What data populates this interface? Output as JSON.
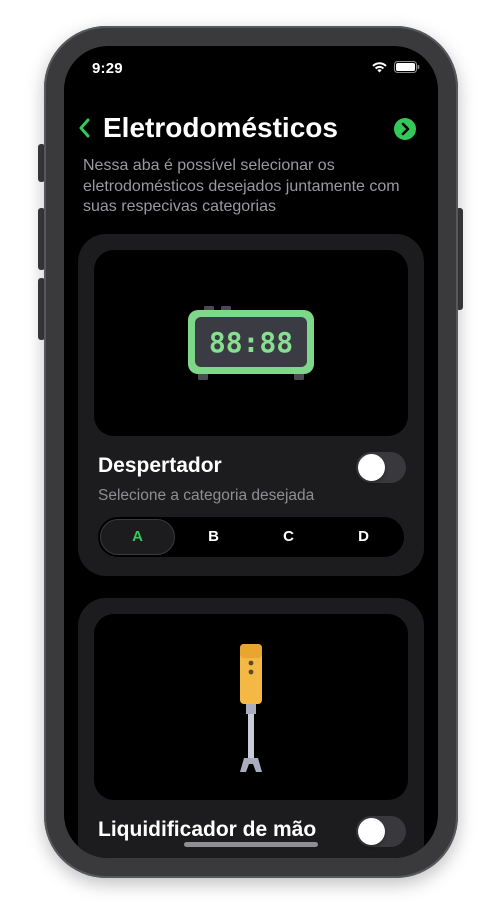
{
  "status_bar": {
    "time": "9:29"
  },
  "header": {
    "title": "Eletrodomésticos",
    "subtitle": "Nessa aba é possível selecionar os eletrodomésticos desejados juntamente com suas respecivas categorias"
  },
  "appliances": [
    {
      "name": "Despertador",
      "hint": "Selecione a categoria desejada",
      "enabled": false,
      "categories": [
        "A",
        "B",
        "C",
        "D"
      ],
      "selected_category": "A"
    },
    {
      "name": "Liquidificador de mão",
      "enabled": false
    }
  ],
  "colors": {
    "accent": "#34c759",
    "background": "#000000",
    "card": "#1c1c1e",
    "clock_glow": "#86e08f",
    "mixer_body": "#f4b844"
  },
  "icons": {
    "back": "chevron-left-icon",
    "next": "chevron-right-circle-icon",
    "appliance_1": "digital-clock-icon",
    "appliance_2": "hand-blender-icon"
  }
}
